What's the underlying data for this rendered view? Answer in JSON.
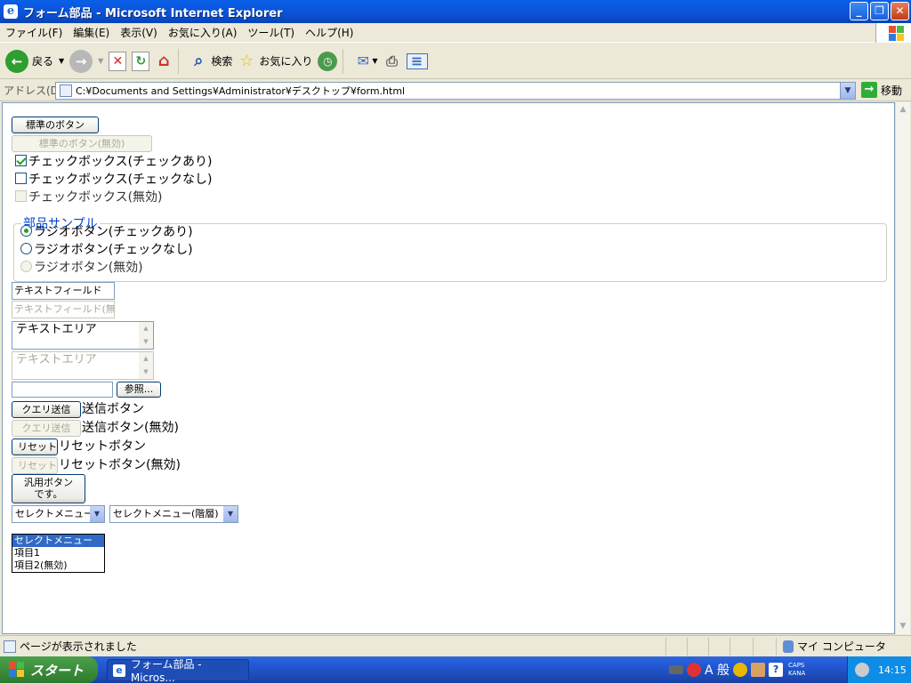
{
  "window": {
    "title": "フォーム部品 - Microsoft Internet Explorer",
    "minimize": "_",
    "maximize": "❐",
    "close": "✕"
  },
  "menu": [
    "ファイル(F)",
    "編集(E)",
    "表示(V)",
    "お気に入り(A)",
    "ツール(T)",
    "ヘルプ(H)"
  ],
  "toolbar": {
    "back": "戻る",
    "search": "検索",
    "favorites": "お気に入り"
  },
  "address": {
    "label": "アドレス(D)",
    "url": "C:¥Documents and Settings¥Administrator¥デスクトップ¥form.html",
    "go": "移動"
  },
  "form": {
    "button_normal": "標準のボタン",
    "button_disabled": "標準のボタン(無効)",
    "checkbox_checked": "チェックボックス(チェックあり)",
    "checkbox_unchecked": "チェックボックス(チェックなし)",
    "checkbox_disabled": "チェックボックス(無効)",
    "fieldset_legend": "部品サンプル",
    "radio_checked": "ラジオボタン(チェックあり)",
    "radio_unchecked": "ラジオボタン(チェックなし)",
    "radio_disabled": "ラジオボタン(無効)",
    "textfield": "テキストフィールド",
    "textfield_disabled": "テキストフィールド(無効)",
    "textarea": "テキストエリア",
    "textarea_disabled": "テキストエリア",
    "file_button": "参照...",
    "submit_button": "クエリ送信",
    "submit_label": "送信ボタン",
    "submit_disabled_button": "クエリ送信",
    "submit_disabled_label": "送信ボタン(無効)",
    "reset_button": "リセット",
    "reset_label": "リセットボタン",
    "reset_disabled_button": "リセット",
    "reset_disabled_label": "リセットボタン(無効)",
    "generic_button_line1": "汎用ボタン",
    "generic_button_line2": "です。",
    "select1": "セレクトメニュー",
    "select2": "セレクトメニュー(階層)",
    "select1_options": [
      "セレクトメニュー",
      "項目1",
      "項目2(無効)"
    ]
  },
  "status": {
    "text": "ページが表示されました",
    "zone": "マイ コンピュータ"
  },
  "taskbar": {
    "start": "スタート",
    "task": "フォーム部品 - Micros...",
    "ime": "A 般",
    "caps": "CAPS",
    "kana": "KANA",
    "clock": "14:15"
  }
}
